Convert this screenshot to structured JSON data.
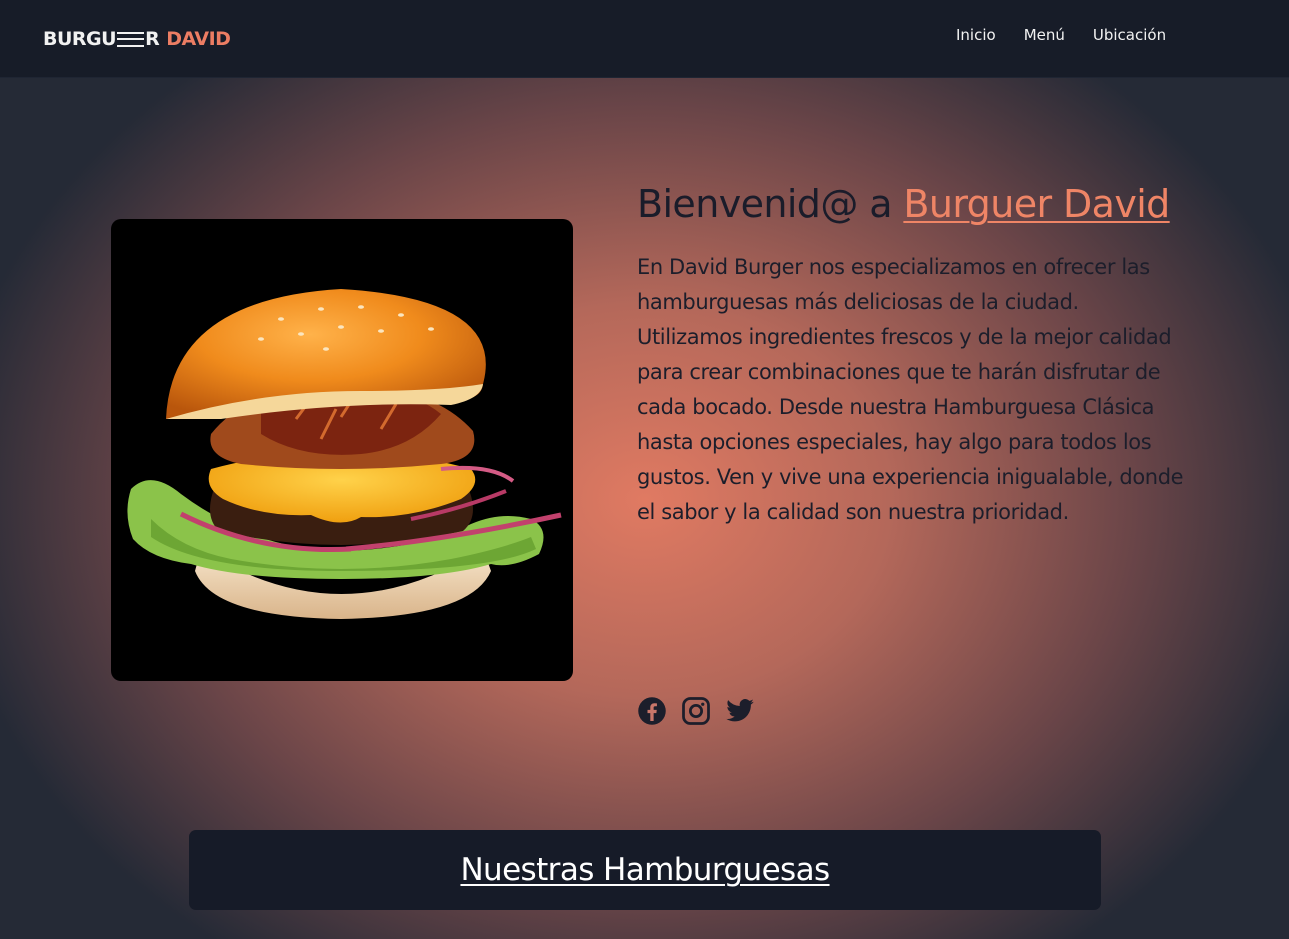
{
  "header": {
    "logo": {
      "part1": "BURGU",
      "part2": "R",
      "part3": "DAVID"
    },
    "nav": [
      "Inicio",
      "Menú",
      "Ubicación"
    ]
  },
  "hero": {
    "image_alt": "burger-photo",
    "title_prefix": "Bienvenid@ a ",
    "title_link": "Burguer David",
    "description": "En David Burger nos especializamos en ofrecer las hamburguesas más deliciosas de la ciudad. Utilizamos ingredientes frescos y de la mejor calidad para crear combinaciones que te harán disfrutar de cada bocado. Desde nuestra Hamburguesa Clásica hasta opciones especiales, hay algo para todos los gustos. Ven y vive una experiencia inigualable, donde el sabor y la calidad son nuestra prioridad.",
    "socials": [
      "facebook-icon",
      "instagram-icon",
      "twitter-icon"
    ]
  },
  "section": {
    "title": "Nuestras Hamburguesas"
  },
  "colors": {
    "navbar": "#171c28",
    "accent": "#ec7d63",
    "text_dark": "#1a1c2a"
  }
}
